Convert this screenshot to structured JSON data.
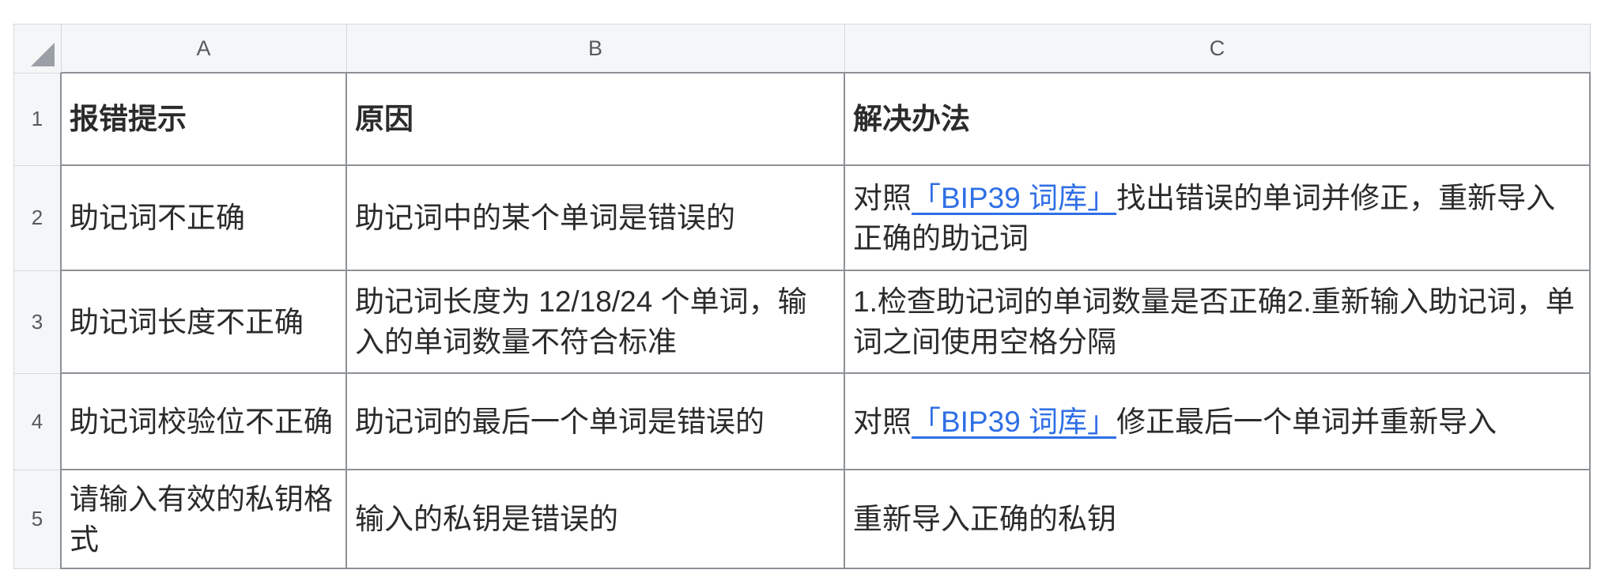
{
  "columns": [
    "A",
    "B",
    "C"
  ],
  "rows": [
    {
      "num": "1",
      "a": "报错提示",
      "b": "原因",
      "c": "解决办法"
    },
    {
      "num": "2",
      "a": "助记词不正确",
      "b": "助记词中的某个单词是错误的",
      "c_pre": "对照",
      "c_link": "「BIP39 词库」",
      "c_post": "找出错误的单词并修正，重新导入正确的助记词"
    },
    {
      "num": "3",
      "a": "助记词长度不正确",
      "b": "助记词长度为 12/18/24 个单词，输入的单词数量不符合标准",
      "c": "1.检查助记词的单词数量是否正确2.重新输入助记词，单词之间使用空格分隔"
    },
    {
      "num": "4",
      "a": "助记词校验位不正确",
      "b": "助记词的最后一个单词是错误的",
      "c_pre": "对照",
      "c_link": "「BIP39 词库」",
      "c_post": "修正最后一个单词并重新导入"
    },
    {
      "num": "5",
      "a": "请输入有效的私钥格式",
      "b": "输入的私钥是错误的",
      "c": "重新导入正确的私钥"
    }
  ],
  "colors": {
    "link": "#2f6fe6",
    "grid": "#8d9196",
    "header_bg": "#f5f6f7"
  }
}
